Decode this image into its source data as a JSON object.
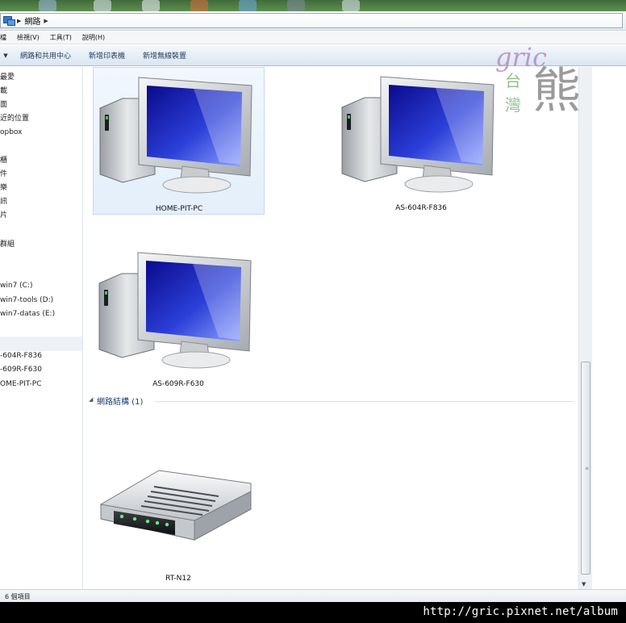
{
  "address": {
    "crumbs": [
      "網路"
    ]
  },
  "menu": {
    "items": [
      "檔",
      "檢視(V)",
      "工具(T)",
      "說明(H)"
    ]
  },
  "toolbar": {
    "buttons": [
      "網路和共用中心",
      "新增印表機",
      "新增無線裝置"
    ]
  },
  "navpane": {
    "items": [
      "最愛",
      "載",
      "面",
      "近的位置",
      "opbox",
      "櫃",
      "件",
      "樂",
      "訊",
      "片",
      "群組",
      "win7 (C:)",
      "win7-tools (D:)",
      "win7-datas (E:)",
      "-604R-F836",
      "-609R-F630",
      "OME-PIT-PC"
    ]
  },
  "computers": [
    {
      "name": "HOME-PIT-PC",
      "selected": true
    },
    {
      "name": "AS-604R-F836",
      "selected": false
    },
    {
      "name": "AS-609R-F630",
      "selected": false
    }
  ],
  "group": {
    "header": "網路結構 (1)"
  },
  "devices": [
    {
      "name": "RT-N12"
    }
  ],
  "status": {
    "text": "6 個項目"
  },
  "watermark": {
    "latin": "gric",
    "char_a": "台",
    "char_b": "灣",
    "char_big": "熊"
  },
  "footer": {
    "url": "http://gric.pixnet.net/album"
  },
  "colors": {
    "screen_blue": "#1414b4",
    "accent_text": "#1e3d7a",
    "selection": "#e4effb"
  }
}
